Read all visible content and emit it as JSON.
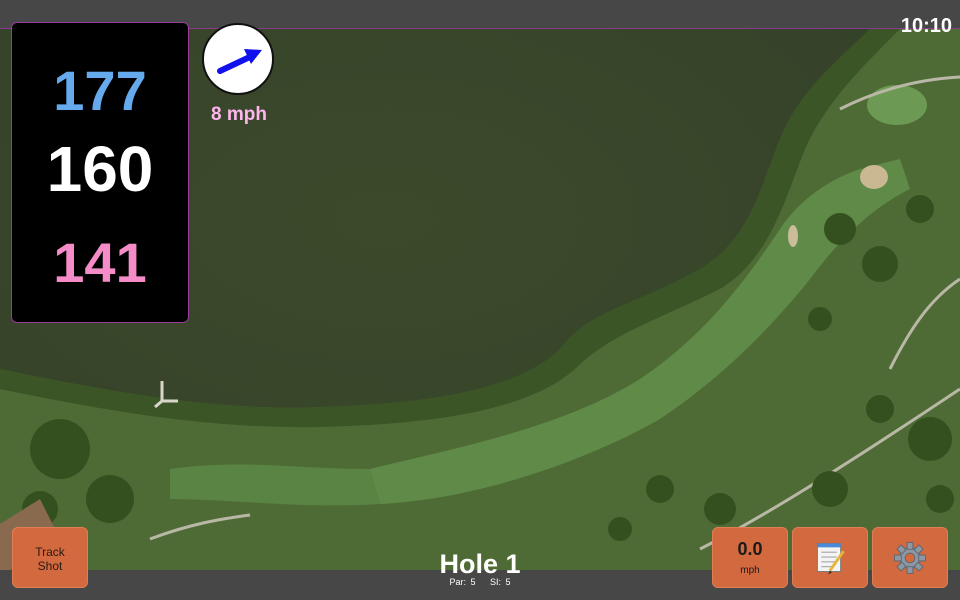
{
  "status_bar": {
    "time": "10:10"
  },
  "distances": {
    "back": "177",
    "center": "160",
    "front": "141"
  },
  "wind": {
    "speed_label": "8 mph",
    "icon": "wind-direction-arrow-icon"
  },
  "hole": {
    "title": "Hole 1",
    "par_label": "Par: 5",
    "si_label": "SI: 5"
  },
  "buttons": {
    "track_shot": [
      "Track",
      "Shot"
    ],
    "speed_value": "0.0",
    "speed_unit": "mph",
    "notes_icon": "notepad-icon",
    "settings_icon": "gear-icon"
  },
  "colors": {
    "back_distance": "#66aaee",
    "center_distance": "#ffffff",
    "front_distance": "#f58cc8",
    "button_bg": "#d2693f",
    "wind_arrow": "#1111ee",
    "wind_text": "#ffb6f0"
  }
}
